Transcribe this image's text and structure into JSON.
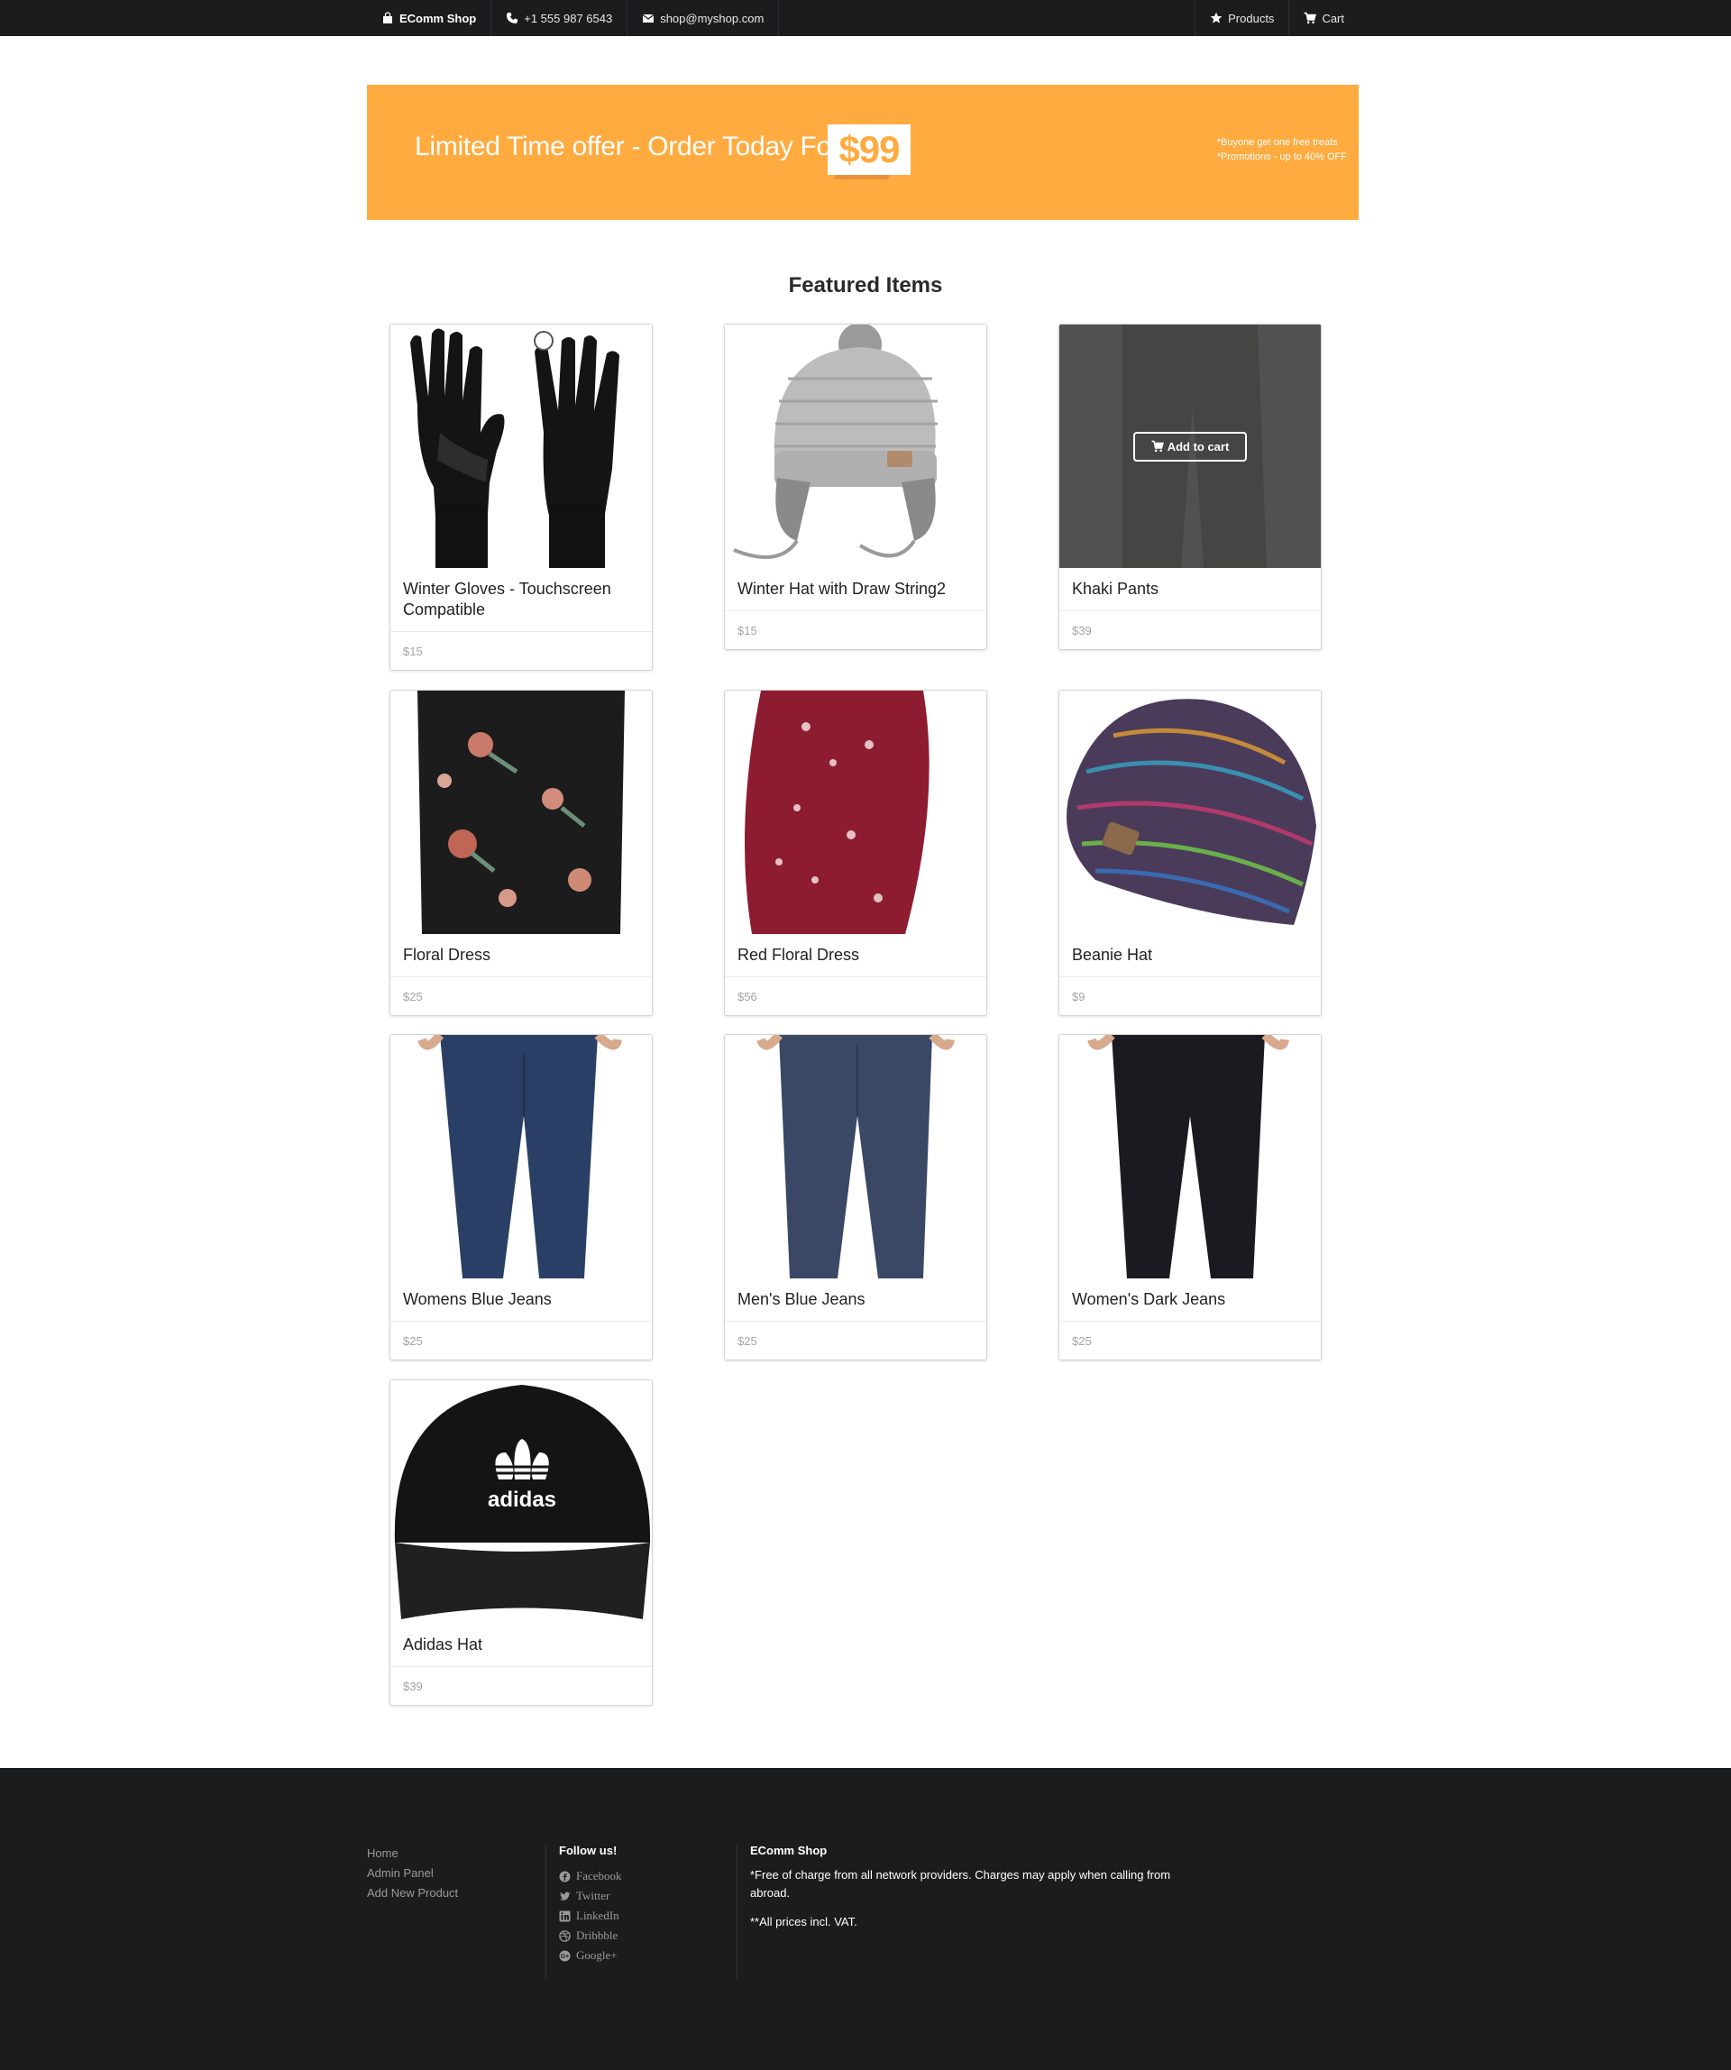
{
  "topbar": {
    "brand": "EComm Shop",
    "phone": "+1 555 987 6543",
    "email": "shop@myshop.com",
    "products_label": "Products",
    "cart_label": "Cart"
  },
  "banner": {
    "text": "Limited Time offer - Order Today For",
    "price": "$99",
    "note_1": "*Buyone get one free treats",
    "note_2": "*Promotions - up to 40% OFF",
    "color": "#ffab40"
  },
  "featured": {
    "title": "Featured Items",
    "add_to_cart": "Add to cart",
    "items": [
      {
        "name": "Winter Gloves - Touchscreen Compatible",
        "price": "$15",
        "image": "gloves"
      },
      {
        "name": "Winter Hat with Draw String2",
        "price": "$15",
        "image": "grey-hat"
      },
      {
        "name": "Khaki Pants",
        "price": "$39",
        "image": "khaki-pants"
      },
      {
        "name": "Floral Dress",
        "price": "$25",
        "image": "floral-dress"
      },
      {
        "name": "Red Floral Dress",
        "price": "$56",
        "image": "red-floral-dress"
      },
      {
        "name": "Beanie Hat",
        "price": "$9",
        "image": "beanie"
      },
      {
        "name": "Womens Blue Jeans",
        "price": "$25",
        "image": "womens-blue-jeans"
      },
      {
        "name": "Men's Blue Jeans",
        "price": "$25",
        "image": "mens-blue-jeans"
      },
      {
        "name": "Women's Dark Jeans",
        "price": "$25",
        "image": "womens-dark-jeans"
      },
      {
        "name": "Adidas Hat",
        "price": "$39",
        "image": "adidas-hat"
      }
    ]
  },
  "footer": {
    "links": [
      "Home",
      "Admin Panel",
      "Add New Product"
    ],
    "follow_title": "Follow us!",
    "social": [
      "Facebook",
      "Twitter",
      "LinkedIn",
      "Dribbble",
      "Google+"
    ],
    "about_title": "EComm Shop",
    "about_text_1": "*Free of charge from all network providers. Charges may apply when calling from abroad.",
    "about_text_2": "**All prices incl. VAT."
  }
}
